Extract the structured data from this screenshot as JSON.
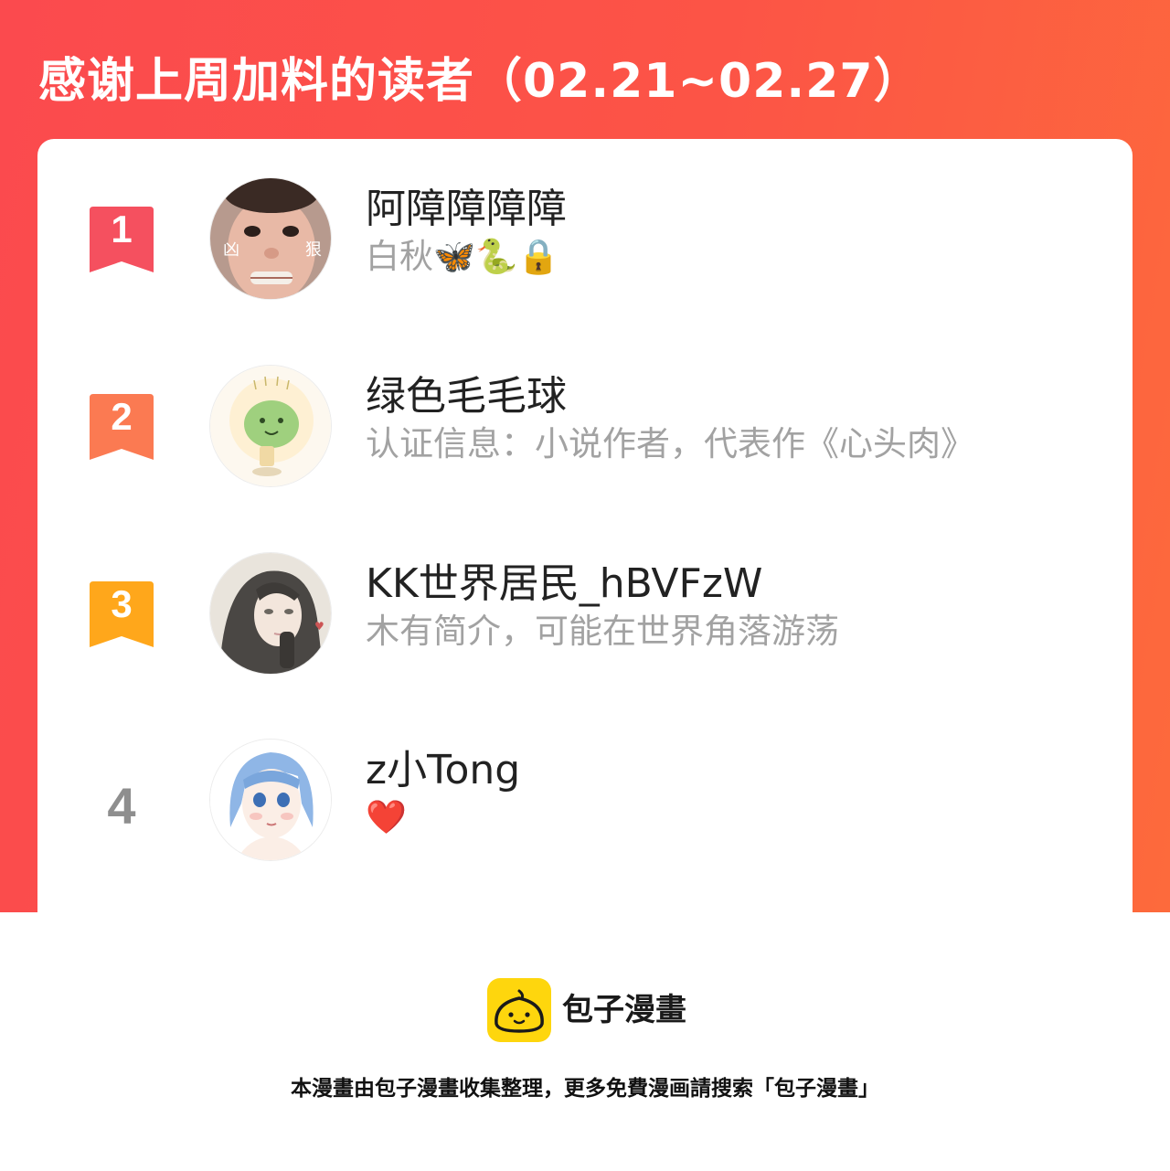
{
  "header": {
    "title": "感谢上周加料的读者（02.21~02.27）"
  },
  "colors": {
    "banner": "#fc5446",
    "rank1": "#f5505f",
    "rank2": "#fb7a52",
    "rank3": "#ffa71b",
    "rank_plain": "#8e8e8e",
    "bio_text": "#a2a2a2",
    "logo_yellow": "#fed60d"
  },
  "readers": [
    {
      "rank": "1",
      "name": "阿障障障障",
      "bio": "白秋🦋🐍🔒",
      "avatar": "crying-child-photo",
      "avatar_text_left": "凶",
      "avatar_text_right": "狠"
    },
    {
      "rank": "2",
      "name": "绿色毛毛球",
      "bio": "认证信息：小说作者，代表作《心头肉》",
      "avatar": "green-fuzzball-drawing"
    },
    {
      "rank": "3",
      "name": "KK世界居民_hBVFzW",
      "bio": "木有简介，可能在世界角落游荡",
      "avatar": "long-hair-illustration"
    },
    {
      "rank": "4",
      "name": "z小Tong",
      "bio": "❤️",
      "avatar": "blue-hair-girl-drawing"
    }
  ],
  "footer": {
    "brand": "包子漫畫",
    "note": "本漫畫由包子漫畫收集整理，更多免費漫画請搜索「包子漫畫」",
    "logo_icon": "bun-face-icon"
  }
}
